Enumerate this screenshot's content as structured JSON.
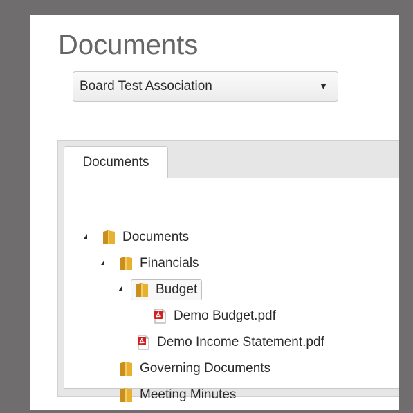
{
  "page": {
    "title": "Documents"
  },
  "association_select": {
    "value": "Board Test Association",
    "arrow": "▼"
  },
  "tabs": [
    {
      "label": "Documents",
      "active": true
    }
  ],
  "tree": {
    "root": {
      "label": "Documents",
      "type": "folder",
      "expanded": true
    },
    "financials": {
      "label": "Financials",
      "type": "folder",
      "expanded": true
    },
    "budget": {
      "label": "Budget",
      "type": "folder",
      "expanded": true,
      "selected": true
    },
    "demo_budget": {
      "label": "Demo Budget.pdf",
      "type": "pdf"
    },
    "demo_income": {
      "label": "Demo Income Statement.pdf",
      "type": "pdf"
    },
    "governing": {
      "label": "Governing Documents",
      "type": "folder",
      "expanded": false
    },
    "minutes": {
      "label": "Meeting Minutes",
      "type": "folder",
      "expanded": false
    }
  },
  "colors": {
    "folder": "#e8b030",
    "folder_dark": "#c98e1c",
    "pdf_red": "#d22020",
    "text": "#2b2b2b",
    "title": "#666666",
    "outer_background": "#6f6d6d"
  },
  "icons": {
    "folder": "folder-icon",
    "pdf": "pdf-icon",
    "expanded": "triangle-expanded-icon",
    "dropdown": "caret-down-icon"
  }
}
